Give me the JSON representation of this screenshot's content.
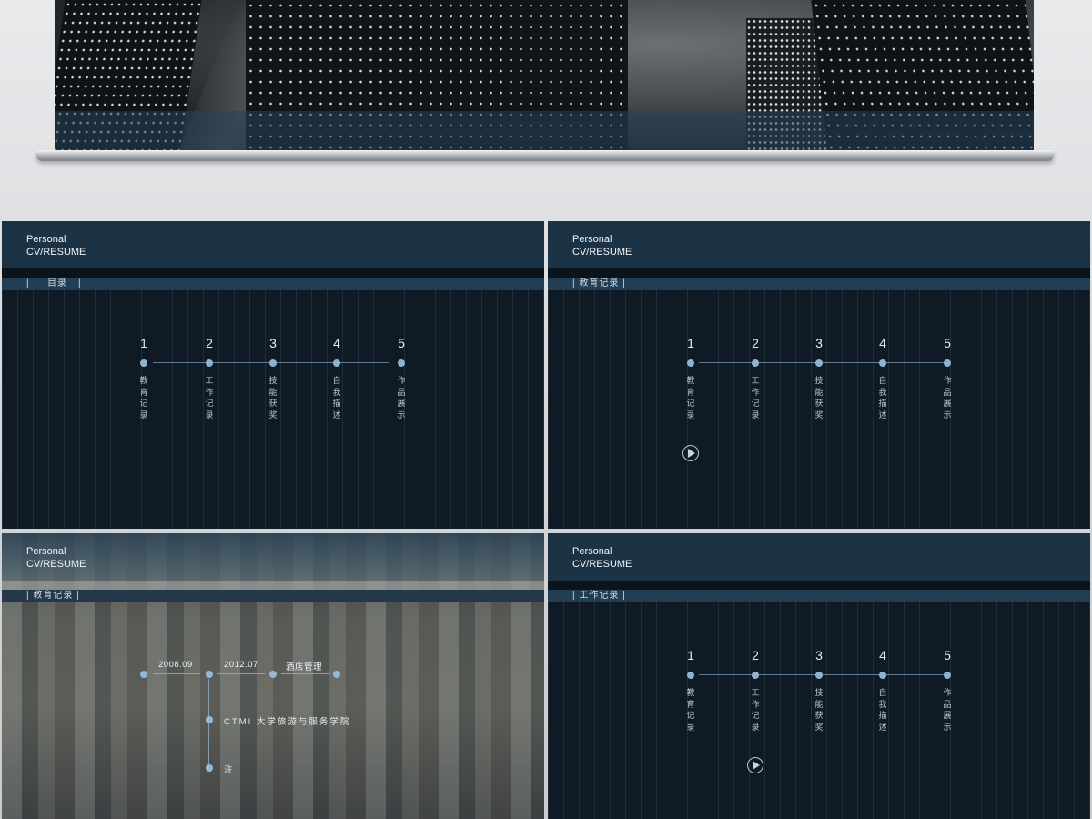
{
  "brand": {
    "line1": "Personal",
    "line2": "CV/RESUME"
  },
  "timeline": {
    "steps": [
      {
        "num": "1",
        "label": "教育记录"
      },
      {
        "num": "2",
        "label": "工作记录"
      },
      {
        "num": "3",
        "label": "技能获奖"
      },
      {
        "num": "4",
        "label": "自我描述"
      },
      {
        "num": "5",
        "label": "作品展示"
      }
    ]
  },
  "slides": {
    "s1": {
      "section": "目录",
      "bar_left": "|",
      "bar_right": "|"
    },
    "s2": {
      "section": "| 教育记录 |"
    },
    "s3": {
      "section": "| 教育记录 |",
      "date_start": "2008.09",
      "date_end": "2012.07",
      "major": "酒店管理",
      "school": "CTMI 大学旅游与服务学院",
      "note": "注"
    },
    "s4": {
      "section": "| 工作记录 |"
    }
  },
  "colors": {
    "accent": "#8fb3cf",
    "header": "#1c3346",
    "background": "#0f1a24"
  }
}
